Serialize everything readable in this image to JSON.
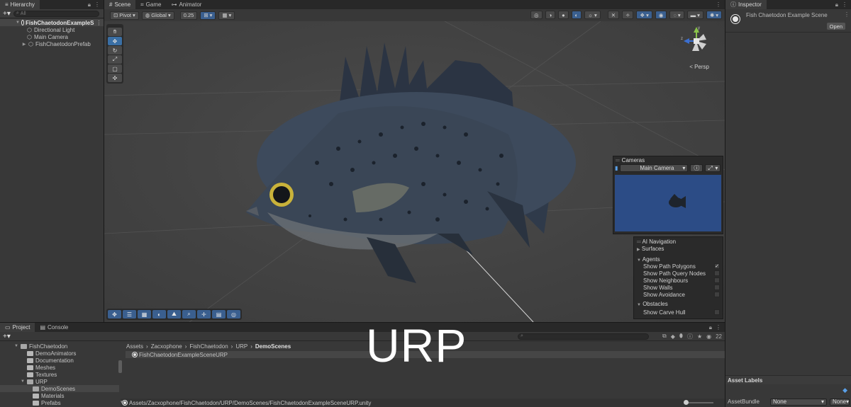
{
  "hierarchy": {
    "tab": "Hierarchy",
    "search_placeholder": "All",
    "items": [
      {
        "label": "FishChaetodonExampleS",
        "depth": 0
      },
      {
        "label": "Directional Light",
        "depth": 1
      },
      {
        "label": "Main Camera",
        "depth": 1
      },
      {
        "label": "FishChaetodonPrefab",
        "depth": 1
      }
    ]
  },
  "scene": {
    "tabs": [
      "Scene",
      "Game",
      "Animator"
    ],
    "toolbar": {
      "pivot": "Pivot",
      "global": "Global",
      "snap": "0.25"
    },
    "view_label": "< Persp",
    "cameras": {
      "title": "Cameras",
      "selected": "Main Camera"
    },
    "ai_nav": {
      "title": "AI Navigation",
      "surfaces": "Surfaces",
      "agents": "Agents",
      "agent_items": [
        {
          "label": "Show Path Polygons",
          "checked": true
        },
        {
          "label": "Show Path Query Nodes",
          "checked": false
        },
        {
          "label": "Show Neighbours",
          "checked": false
        },
        {
          "label": "Show Walls",
          "checked": false
        },
        {
          "label": "Show Avoidance",
          "checked": false
        }
      ],
      "obstacles": "Obstacles",
      "obstacle_items": [
        {
          "label": "Show Carve Hull",
          "checked": false
        }
      ]
    }
  },
  "inspector": {
    "tab": "Inspector",
    "title": "Fish Chaetodon Example Scene",
    "open_label": "Open",
    "asset_labels": "Asset Labels",
    "asset_bundle_label": "AssetBundle",
    "asset_bundle_value": "None",
    "asset_variant_value": "None"
  },
  "project": {
    "tabs": [
      "Project",
      "Console"
    ],
    "tree": [
      {
        "label": "FishChaetodon",
        "depth": 0
      },
      {
        "label": "DemoAnimators",
        "depth": 1
      },
      {
        "label": "Documentation",
        "depth": 1
      },
      {
        "label": "Meshes",
        "depth": 1
      },
      {
        "label": "Textures",
        "depth": 1
      },
      {
        "label": "URP",
        "depth": 1
      },
      {
        "label": "DemoScenes",
        "depth": 2
      },
      {
        "label": "Materials",
        "depth": 2
      },
      {
        "label": "Prefabs",
        "depth": 2
      }
    ],
    "breadcrumb": [
      "Assets",
      "Zacxophone",
      "FishChaetodon",
      "URP",
      "DemoScenes"
    ],
    "file": "FishChaetodonExampleSceneURP",
    "path": "Assets/Zacxophone/FishChaetodon/URP/DemoScenes/FishChaetodonExampleSceneURP.unity",
    "count": "22"
  },
  "overlay_text": "URP"
}
